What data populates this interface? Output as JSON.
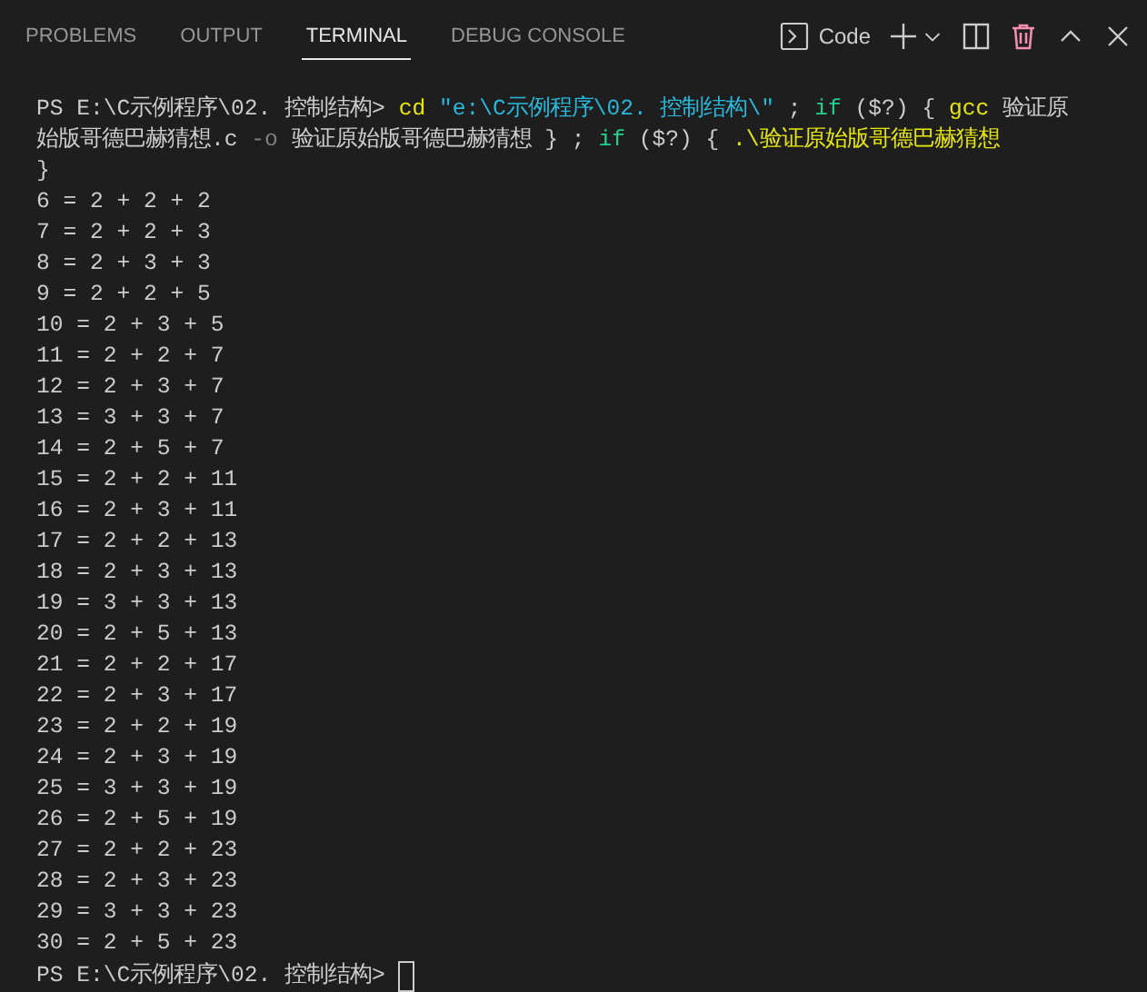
{
  "tabs": [
    {
      "label": "PROBLEMS",
      "selected": false
    },
    {
      "label": "OUTPUT",
      "selected": false
    },
    {
      "label": "TERMINAL",
      "selected": true
    },
    {
      "label": "DEBUG CONSOLE",
      "selected": false
    }
  ],
  "terminal_profile": {
    "label": "Code"
  },
  "command_lines": [
    [
      {
        "kind": "plain",
        "text": "PS E:\\C示例程序\\02. 控制结构> "
      },
      {
        "kind": "command",
        "text": "cd "
      },
      {
        "kind": "string",
        "text": "\"e:\\C示例程序\\02. 控制结构\\\""
      },
      {
        "kind": "plain",
        "text": " ; "
      },
      {
        "kind": "keyword",
        "text": "if"
      },
      {
        "kind": "plain",
        "text": " ($?) { "
      },
      {
        "kind": "command",
        "text": "gcc"
      },
      {
        "kind": "plain",
        "text": " 验证原"
      }
    ],
    [
      {
        "kind": "plain",
        "text": "始版哥德巴赫猜想.c "
      },
      {
        "kind": "param",
        "text": "-o"
      },
      {
        "kind": "plain",
        "text": " 验证原始版哥德巴赫猜想 } ; "
      },
      {
        "kind": "keyword",
        "text": "if"
      },
      {
        "kind": "plain",
        "text": " ($?) { "
      },
      {
        "kind": "command",
        "text": ".\\验证原始版哥德巴赫猜想"
      }
    ],
    [
      {
        "kind": "plain",
        "text": "}"
      }
    ]
  ],
  "output_lines": [
    "6 = 2 + 2 + 2",
    "7 = 2 + 2 + 3",
    "8 = 2 + 3 + 3",
    "9 = 2 + 2 + 5",
    "10 = 2 + 3 + 5",
    "11 = 2 + 2 + 7",
    "12 = 2 + 3 + 7",
    "13 = 3 + 3 + 7",
    "14 = 2 + 5 + 7",
    "15 = 2 + 2 + 11",
    "16 = 2 + 3 + 11",
    "17 = 2 + 2 + 13",
    "18 = 2 + 3 + 13",
    "19 = 3 + 3 + 13",
    "20 = 2 + 5 + 13",
    "21 = 2 + 2 + 17",
    "22 = 2 + 3 + 17",
    "23 = 2 + 2 + 19",
    "24 = 2 + 3 + 19",
    "25 = 3 + 3 + 19",
    "26 = 2 + 5 + 19",
    "27 = 2 + 2 + 23",
    "28 = 2 + 3 + 23",
    "29 = 3 + 3 + 23",
    "30 = 2 + 5 + 23"
  ],
  "prompt": "PS E:\\C示例程序\\02. 控制结构> "
}
